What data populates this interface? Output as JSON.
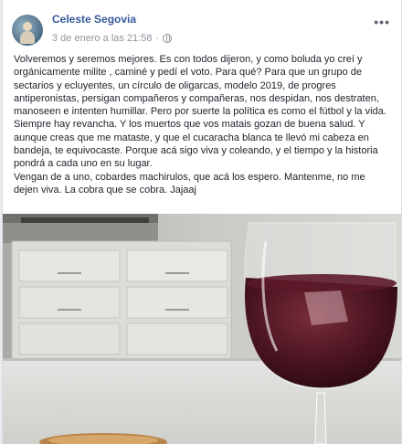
{
  "post": {
    "author": "Celeste Segovia",
    "timestamp": "3 de enero a las 21:58",
    "separator": "·",
    "more_label": "•••",
    "paragraphs": [
      "Volveremos y seremos mejores. Es con todos dijeron, y como boluda yo creí y orgánicamente milite , caminé y pedí el voto. Para qué? Para que un grupo de sectarios y ecluyentes, un círculo de oligarcas, modelo 2019, de progres antiperonistas, persigan compañeros y compañeras, nos despidan, nos destraten, manoseen e intenten humillar. Pero por suerte la política es como el fútbol y la vida. Siempre hay revancha. Y los muertos que vos matais gozan de buena salud. Y aunque creas que me mataste, y que el cucaracha blanca te llevó mi cabeza en bandeja, te equivocaste. Porque acá sigo viva y coleando, y el tiempo y la historia pondrá a cada uno en su lugar.",
      "Vengan de a uno, cobardes machirulos, que acá los espero. Mantenme, no me dejen viva. La cobra que se cobra. Jajaaj"
    ]
  },
  "icons": {
    "avatar": "profile-photo",
    "privacy": "globe-icon",
    "more": "more-options-icon"
  },
  "colors": {
    "name_link": "#365899",
    "meta_text": "#90949c",
    "body_text": "#1d2129",
    "page_bg": "#e9ebee"
  }
}
